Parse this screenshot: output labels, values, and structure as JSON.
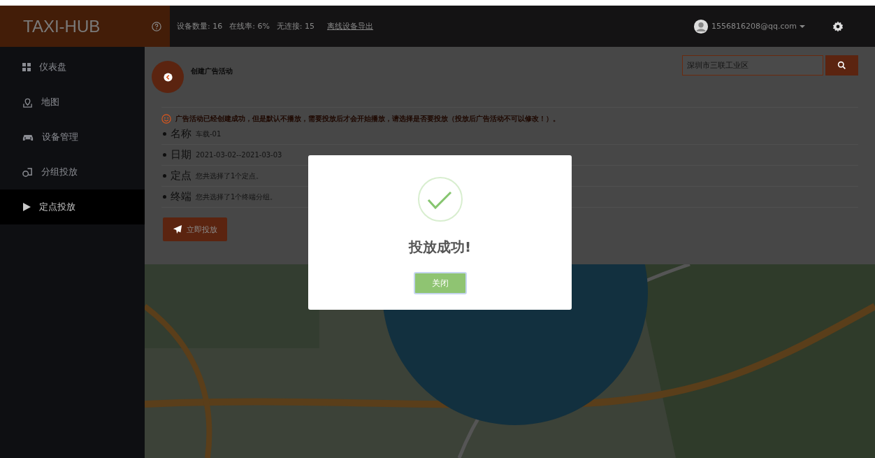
{
  "header": {
    "logo": "TAXI-HUB",
    "stats": [
      "设备数量: 16",
      "在线率: 6%",
      "无连接: 15"
    ],
    "export_link": "离线设备导出",
    "user_email": "1556816208@qq.com"
  },
  "sidebar": {
    "items": [
      {
        "label": "仪表盘",
        "selected": false
      },
      {
        "label": "地图",
        "selected": false
      },
      {
        "label": "设备管理",
        "selected": false
      },
      {
        "label": "分组投放",
        "selected": false
      },
      {
        "label": "定点投放",
        "selected": true
      }
    ]
  },
  "content": {
    "title": "创建广告活动",
    "notice": "广告活动已经创建成功，但是默认不播放，需要投放后才会开始播放，请选择是否要投放（投放后广告活动不可以修改！）。",
    "fields": [
      {
        "label": "名称",
        "value": "车载-01"
      },
      {
        "label": "日期",
        "value": "2021-03-02--2021-03-03"
      },
      {
        "label": "定点",
        "value": "您共选择了1个定点。"
      },
      {
        "label": "终端",
        "value": "您共选择了1个终端分组。"
      }
    ],
    "submit_button": "立即投放"
  },
  "search": {
    "value": "深圳市三联工业区"
  },
  "modal": {
    "title": "投放成功!",
    "button": "关闭"
  }
}
